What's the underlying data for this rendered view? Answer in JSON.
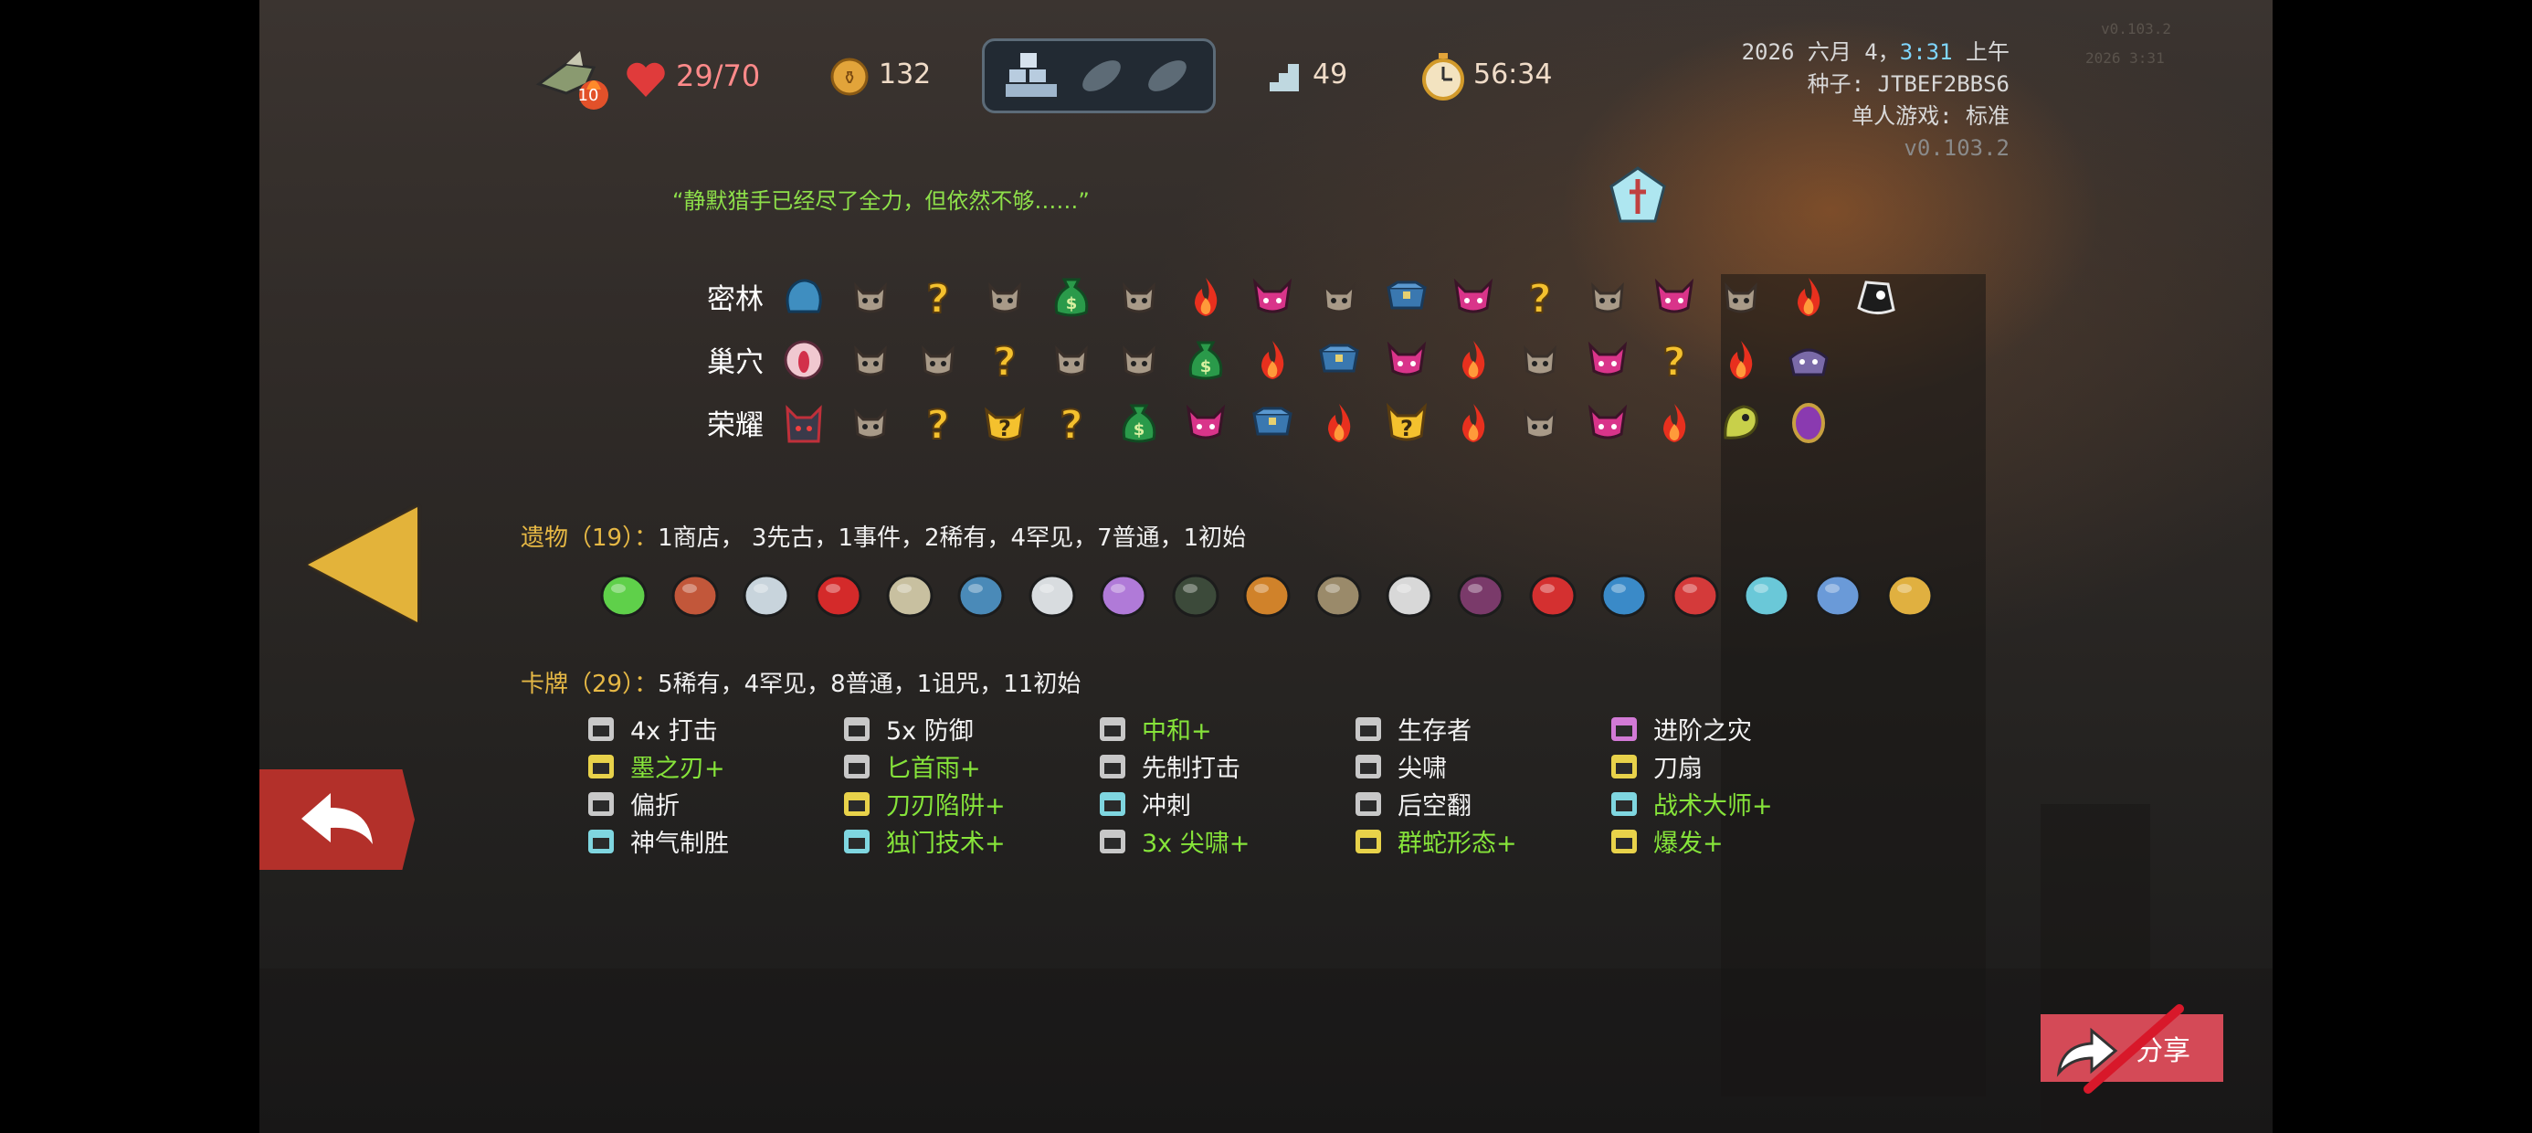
{
  "hud": {
    "character_level": "10",
    "hp": "29/70",
    "gold": "132",
    "floor": "49",
    "time": "56:34"
  },
  "info": {
    "datetime_prefix": "2026 六月 4，",
    "datetime_time": "3:31",
    "datetime_suffix": " 上午",
    "seed": "种子: JTBEF2BBS6",
    "mode": "单人游戏: 标准",
    "version": "v0.103.2",
    "faint_1": "v0.103.2",
    "faint_2": "2026 3:31"
  },
  "quote": "“静默猎手已经尽了全力，但依然不够……”",
  "map": {
    "rows": [
      {
        "label": "密林",
        "icons": [
          "boss-slime",
          "monster",
          "unknown",
          "monster",
          "treasure-bag",
          "monster",
          "rest",
          "elite",
          "monster",
          "chest",
          "elite",
          "unknown",
          "monster",
          "elite",
          "monster",
          "rest",
          "boss-black"
        ]
      },
      {
        "label": "巢穴",
        "icons": [
          "boss-eye",
          "monster",
          "monster",
          "unknown",
          "monster",
          "monster",
          "treasure-bag",
          "rest",
          "chest",
          "elite",
          "rest",
          "monster",
          "elite",
          "unknown",
          "rest",
          "boss-purple"
        ]
      },
      {
        "label": "荣耀",
        "icons": [
          "boss-dark",
          "monster",
          "unknown",
          "unknown-monster",
          "unknown",
          "treasure-bag",
          "elite",
          "chest",
          "rest",
          "unknown-elite",
          "rest",
          "monster",
          "elite",
          "rest",
          "boss-yellow",
          "boss-orb"
        ]
      }
    ]
  },
  "relics": {
    "header": "遗物（19）：",
    "summary": "1商店， 3先古，1事件，2稀有，4罕见，7普通，1初始",
    "items": [
      "green-ring",
      "meat",
      "smooth-stone",
      "red-envelope",
      "candelabra",
      "anvil",
      "pale-egg",
      "voodoo-doll",
      "dark-egg",
      "treasure-box",
      "snail-shell",
      "sickle",
      "violin",
      "red-pillow",
      "anchor",
      "red-chest",
      "crystal-gem",
      "scroll",
      "golden-vajra"
    ]
  },
  "cards": {
    "header": "卡牌（29）：",
    "summary": "5稀有，4罕见，8普通，1诅咒，11初始",
    "columns": [
      [
        {
          "name": "4x 打击",
          "upgraded": false,
          "color": "#c8c8c8"
        },
        {
          "name": "墨之刃+",
          "upgraded": true,
          "color": "#e8d24a"
        },
        {
          "name": "偏折",
          "upgraded": false,
          "color": "#c8c8c8"
        },
        {
          "name": "神气制胜",
          "upgraded": false,
          "color": "#7fd6e0"
        }
      ],
      [
        {
          "name": "5x 防御",
          "upgraded": false,
          "color": "#c8c8c8"
        },
        {
          "name": "匕首雨+",
          "upgraded": true,
          "color": "#c8c8c8"
        },
        {
          "name": "刀刃陷阱+",
          "upgraded": true,
          "color": "#e8d24a"
        },
        {
          "name": "独门技术+",
          "upgraded": true,
          "color": "#7fd6e0"
        }
      ],
      [
        {
          "name": "中和+",
          "upgraded": true,
          "color": "#c8c8c8"
        },
        {
          "name": "先制打击",
          "upgraded": false,
          "color": "#c8c8c8"
        },
        {
          "name": "冲刺",
          "upgraded": false,
          "color": "#7fd6e0"
        },
        {
          "name": "3x 尖啸+",
          "upgraded": true,
          "color": "#c8c8c8"
        }
      ],
      [
        {
          "name": "生存者",
          "upgraded": false,
          "color": "#c8c8c8"
        },
        {
          "name": "尖啸",
          "upgraded": false,
          "color": "#c8c8c8"
        },
        {
          "name": "后空翻",
          "upgraded": false,
          "color": "#c8c8c8"
        },
        {
          "name": "群蛇形态+",
          "upgraded": true,
          "color": "#e8d24a"
        }
      ],
      [
        {
          "name": "进阶之灾",
          "upgraded": false,
          "color": "#d27ad6"
        },
        {
          "name": "刀扇",
          "upgraded": false,
          "color": "#e8d24a"
        },
        {
          "name": "战术大师+",
          "upgraded": true,
          "color": "#7fd6e0"
        },
        {
          "name": "爆发+",
          "upgraded": true,
          "color": "#e8d24a"
        }
      ]
    ]
  },
  "share_label": "分享"
}
